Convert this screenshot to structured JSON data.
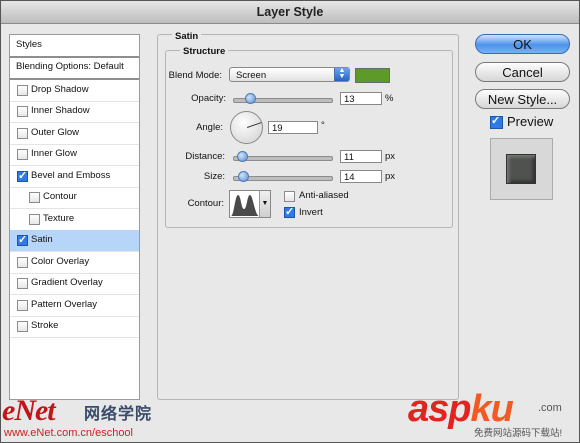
{
  "window": {
    "title": "Layer Style"
  },
  "styles_list": {
    "header": "Styles",
    "blending_options": "Blending Options: Default",
    "items": [
      {
        "label": "Drop Shadow",
        "checked": false,
        "sub": false
      },
      {
        "label": "Inner Shadow",
        "checked": false,
        "sub": false
      },
      {
        "label": "Outer Glow",
        "checked": false,
        "sub": false
      },
      {
        "label": "Inner Glow",
        "checked": false,
        "sub": false
      },
      {
        "label": "Bevel and Emboss",
        "checked": true,
        "sub": false
      },
      {
        "label": "Contour",
        "checked": false,
        "sub": true
      },
      {
        "label": "Texture",
        "checked": false,
        "sub": true
      },
      {
        "label": "Satin",
        "checked": true,
        "sub": false,
        "selected": true
      },
      {
        "label": "Color Overlay",
        "checked": false,
        "sub": false
      },
      {
        "label": "Gradient Overlay",
        "checked": false,
        "sub": false
      },
      {
        "label": "Pattern Overlay",
        "checked": false,
        "sub": false
      },
      {
        "label": "Stroke",
        "checked": false,
        "sub": false
      }
    ]
  },
  "satin": {
    "section_title": "Satin",
    "structure_title": "Structure",
    "blend_mode": {
      "label": "Blend Mode:",
      "value": "Screen",
      "color": "#5e9a27"
    },
    "opacity": {
      "label": "Opacity:",
      "value": "13",
      "unit": "%",
      "level": 0.13
    },
    "angle": {
      "label": "Angle:",
      "value": "19",
      "unit": "°"
    },
    "distance": {
      "label": "Distance:",
      "value": "11",
      "unit": "px",
      "level": 0.045
    },
    "size": {
      "label": "Size:",
      "value": "14",
      "unit": "px",
      "level": 0.055
    },
    "contour": {
      "label": "Contour:"
    },
    "anti_aliased": {
      "label": "Anti-aliased",
      "checked": false
    },
    "invert": {
      "label": "Invert",
      "checked": true
    }
  },
  "buttons": {
    "ok": "OK",
    "cancel": "Cancel",
    "new_style": "New Style..."
  },
  "preview": {
    "label": "Preview",
    "checked": true,
    "swatch_color": "#4f524f"
  },
  "watermarks": {
    "left_logo": "eNet",
    "left_cn": "网络学院",
    "left_url": "www.eNet.com.cn/eschool",
    "right_logo_a": "asp",
    "right_logo_b": "ku",
    "right_com": ".com",
    "right_cn": "免费网站源码下载站!"
  }
}
